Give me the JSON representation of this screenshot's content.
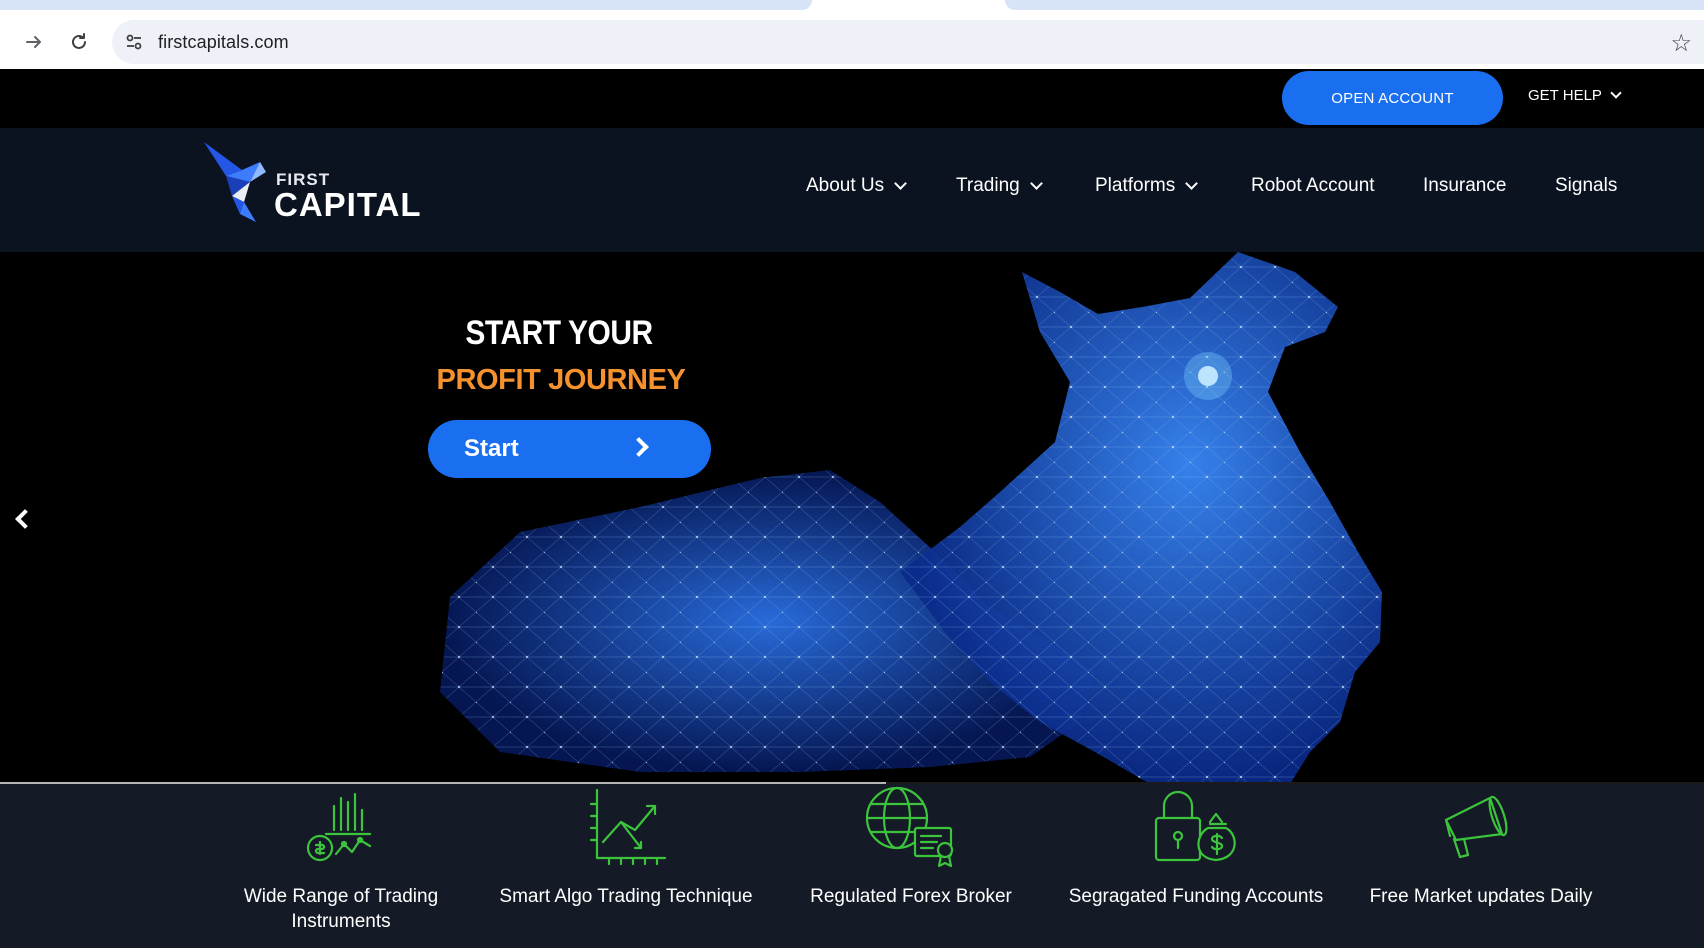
{
  "browser": {
    "url": "firstcapitals.com",
    "icons": [
      "forward-icon",
      "reload-icon",
      "site-settings-icon",
      "bookmark-star-icon"
    ]
  },
  "topbar": {
    "open_account_label": "OPEN ACCOUNT",
    "get_help_label": "GET HELP"
  },
  "brand": {
    "first": "FIRST",
    "capital": "CAPITAL",
    "accent": "#1a6ff0"
  },
  "nav": {
    "items": [
      {
        "label": "About Us",
        "dropdown": true
      },
      {
        "label": "Trading",
        "dropdown": true
      },
      {
        "label": "Platforms",
        "dropdown": true
      },
      {
        "label": "Robot Account",
        "dropdown": false
      },
      {
        "label": "Insurance",
        "dropdown": false
      },
      {
        "label": "Signals",
        "dropdown": false
      }
    ]
  },
  "hero": {
    "headline_line1": "START YOUR",
    "headline_line2": "PROFIT JOURNEY",
    "cta_label": "Start",
    "slider_progress": 0.52,
    "colors": {
      "headline_accent": "#f6922e",
      "button": "#1a6ff0"
    }
  },
  "features": {
    "icon_color": "#3cc43c",
    "items": [
      {
        "label": "Wide Range of Trading Instruments",
        "icon": "trading-instruments-icon"
      },
      {
        "label": "Smart Algo Trading Technique",
        "icon": "algo-chart-icon"
      },
      {
        "label": "Regulated Forex Broker",
        "icon": "globe-certificate-icon"
      },
      {
        "label": "Segragated Funding Accounts",
        "icon": "lock-money-bag-icon"
      },
      {
        "label": "Free Market updates Daily",
        "icon": "megaphone-icon"
      }
    ]
  }
}
